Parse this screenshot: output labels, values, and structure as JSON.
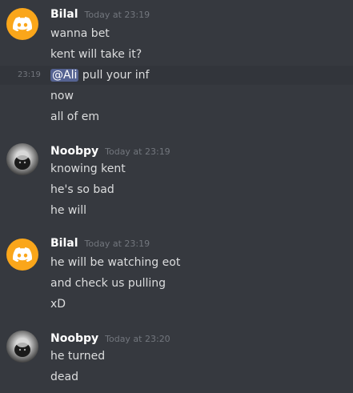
{
  "messages": [
    {
      "author": "Bilal",
      "time": "Today at 23:19",
      "avatar_icon": "discord-logo-icon",
      "lines": [
        {
          "text": "wanna bet"
        },
        {
          "text": "kent will take it?"
        },
        {
          "hover_time": "23:19",
          "mention": "@Ali",
          "text": "pull your inf"
        },
        {
          "text": "now"
        },
        {
          "text": "all of em"
        }
      ]
    },
    {
      "author": "Noobpy",
      "time": "Today at 23:19",
      "avatar_icon": "user-avatar-icon",
      "lines": [
        {
          "text": "knowing kent"
        },
        {
          "text": "he's so bad"
        },
        {
          "text": "he will"
        }
      ]
    },
    {
      "author": "Bilal",
      "time": "Today at 23:19",
      "avatar_icon": "discord-logo-icon",
      "lines": [
        {
          "text": "he will be watching eot"
        },
        {
          "text": "and check us pulling"
        },
        {
          "text": "xD"
        }
      ]
    },
    {
      "author": "Noobpy",
      "time": "Today at 23:20",
      "avatar_icon": "user-avatar-icon",
      "lines": [
        {
          "text": "he turned"
        },
        {
          "text": "dead"
        }
      ]
    }
  ],
  "colors": {
    "background": "#36393f",
    "avatar_orange": "#faa61a",
    "mention_blue": "#7289da"
  }
}
